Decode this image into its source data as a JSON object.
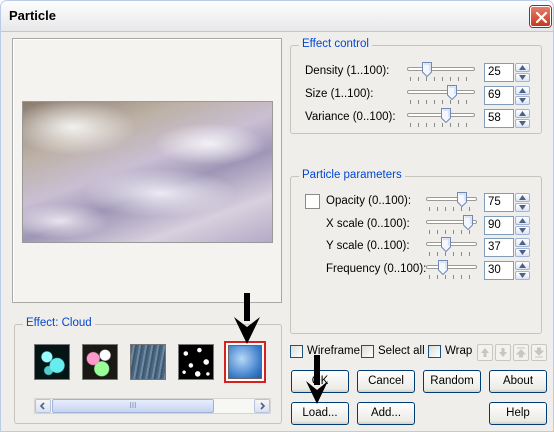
{
  "window": {
    "title": "Particle"
  },
  "effect_control": {
    "label": "Effect control",
    "rows": [
      {
        "label": "Density (1..100):",
        "value": "25",
        "level": 25
      },
      {
        "label": "Size (1..100):",
        "value": "69",
        "level": 69
      },
      {
        "label": "Variance (0..100):",
        "value": "58",
        "level": 58
      }
    ]
  },
  "particle_parameters": {
    "label": "Particle parameters",
    "opacity_label": "Opacity (0..100):",
    "opacity_value": "75",
    "opacity_level": 75,
    "rows": [
      {
        "label": "X scale (0..100):",
        "value": "90",
        "level": 90
      },
      {
        "label": "Y scale (0..100):",
        "value": "37",
        "level": 37
      },
      {
        "label": "Frequency (0..100):",
        "value": "30",
        "level": 30
      }
    ]
  },
  "effect_gallery": {
    "label": "Effect: Cloud",
    "selected_index": 4,
    "scroll_thumb_label": "III"
  },
  "options": {
    "wireframe": "Wireframe",
    "select_all": "Select all",
    "wrap": "Wrap"
  },
  "buttons": {
    "ok": "OK",
    "cancel": "Cancel",
    "random": "Random",
    "about": "About",
    "load": "Load...",
    "add": "Add...",
    "help": "Help"
  },
  "colors": {
    "group_label": "#0046d5",
    "selected_border": "#d82020",
    "close_button": "#c4391f"
  }
}
